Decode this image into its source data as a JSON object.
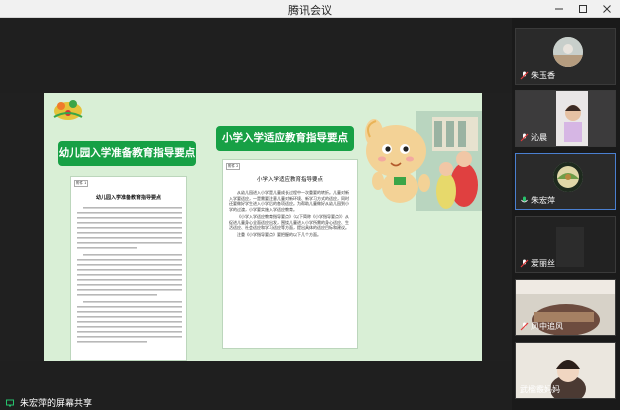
{
  "window": {
    "title": "腾讯会议",
    "controls": [
      "minimize",
      "maximize",
      "close"
    ]
  },
  "share": {
    "presenter_label": "朱宏萍的屏幕共享",
    "slide": {
      "left_heading": "幼儿园入学准备教育指导要点",
      "right_heading": "小学入学适应教育指导要点",
      "left_doc": {
        "tag": "附件 1",
        "title": "幼儿园入学准备教育指导要点"
      },
      "right_doc": {
        "tag": "附件 2",
        "title": "小学入学适应教育指导要点",
        "paragraphs": [
          "从幼儿园进入小学是儿童成长过程中一次重要的转折。儿童对新入学要适应，一是需要注意儿童对新环境、新学习方式的适应，同时还要做好学生进入小学后的各项适应。为帮助儿童做好从幼儿园到小学的过渡，小学要实施入学适应教育。",
          "《小学入学适应教育指导要点》（以下简称《小学指导要点》）从促进儿童身心全面适应出发，围绕儿童进入小学所需的身心适应、生活适应、社会适应和学习适应等方面，提出具体的适应目标和建议。",
          "注重《小学指导要点》要把握的以下几个方面。"
        ]
      }
    }
  },
  "participants": [
    {
      "name": "朱玉香",
      "mic": "muted"
    },
    {
      "name": "沁晨",
      "mic": "muted"
    },
    {
      "name": "朱宏萍",
      "mic": "active"
    },
    {
      "name": "",
      "mic": "muted"
    },
    {
      "name": "爱丽丝",
      "mic": "muted"
    },
    {
      "name": "风中追风",
      "mic": "muted"
    },
    {
      "name": "武楹霰妈妈",
      "mic": "muted"
    }
  ],
  "colors": {
    "accent_green": "#17a045",
    "slide_bg": "#d9efd6",
    "mic_muted_red": "#e23b3b",
    "mic_active_green": "#27c26c"
  }
}
